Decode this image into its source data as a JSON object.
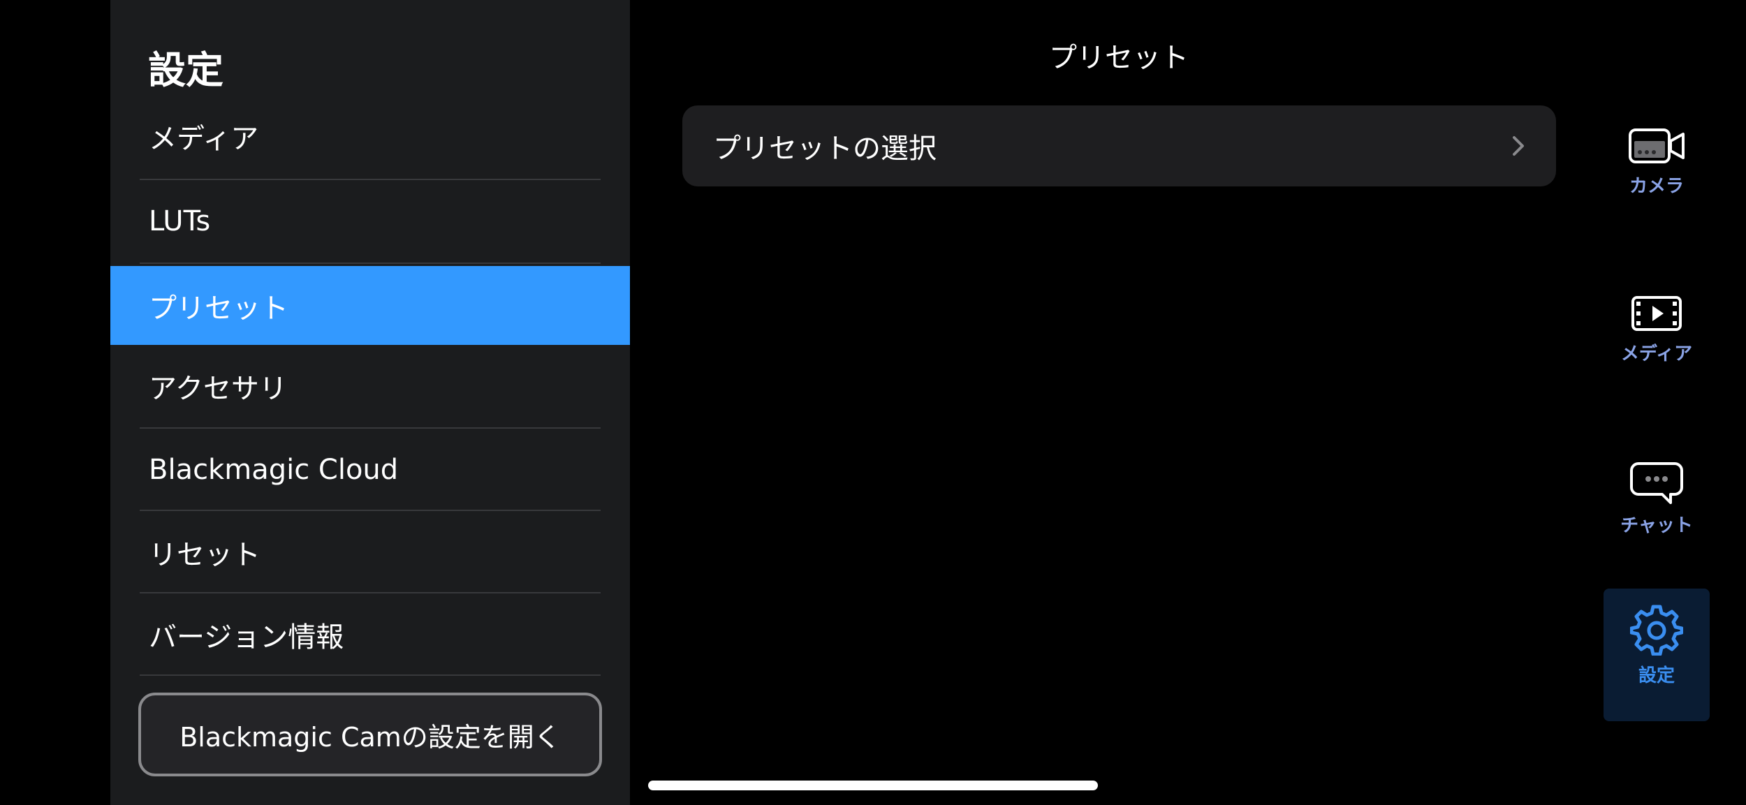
{
  "sidebar": {
    "title": "設定",
    "items": [
      {
        "label": "メディア"
      },
      {
        "label": "LUTs"
      },
      {
        "label": "プリセット"
      },
      {
        "label": "アクセサリ"
      },
      {
        "label": "Blackmagic Cloud"
      },
      {
        "label": "リセット"
      },
      {
        "label": "バージョン情報"
      }
    ],
    "open_settings_button": "Blackmagic Camの設定を開く"
  },
  "main": {
    "title": "プリセット",
    "rows": [
      {
        "label": "プリセットの選択"
      }
    ]
  },
  "rail": {
    "items": [
      {
        "label": "カメラ",
        "icon": "camera-icon"
      },
      {
        "label": "メディア",
        "icon": "media-icon"
      },
      {
        "label": "チャット",
        "icon": "chat-icon"
      },
      {
        "label": "設定",
        "icon": "gear-icon"
      }
    ]
  },
  "colors": {
    "accent": "#3399ff",
    "rail_label": "#8aa3e6",
    "rail_active_label": "#3a8ef0"
  }
}
